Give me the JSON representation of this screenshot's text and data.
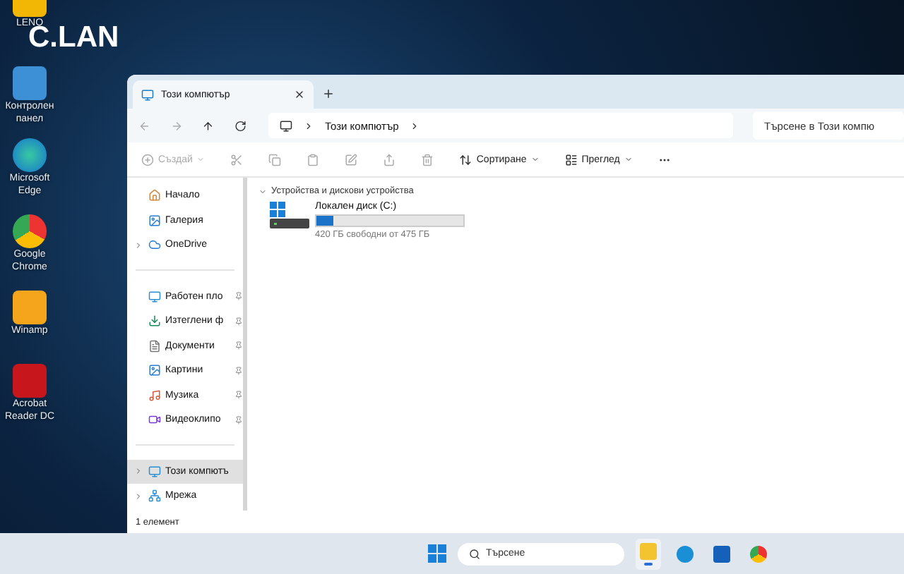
{
  "wallpaper_caption": "C.LAN",
  "desktop_icons": [
    {
      "label": "LENO"
    },
    {
      "label": "Контролен панел"
    },
    {
      "label": "Microsoft Edge"
    },
    {
      "label": "Google Chrome"
    },
    {
      "label": "Winamp"
    },
    {
      "label": "Acrobat Reader DC"
    }
  ],
  "window": {
    "tabs": [
      {
        "label": "Този компютър",
        "selected": true
      }
    ],
    "nav_buttons": [
      {
        "disabled": true
      },
      {
        "disabled": true
      },
      {
        "disabled": false
      },
      {
        "disabled": false
      }
    ],
    "breadcrumb": [
      "Този компютър"
    ],
    "search": {
      "placeholder": "Търсене в Този компю"
    },
    "commands": [
      {
        "kind": "menu",
        "label": "Създай",
        "disabled": true
      },
      {
        "kind": "icon",
        "disabled": true
      },
      {
        "kind": "icon",
        "disabled": true
      },
      {
        "kind": "icon",
        "disabled": true
      },
      {
        "kind": "icon",
        "disabled": true
      },
      {
        "kind": "icon",
        "disabled": true
      },
      {
        "kind": "icon",
        "disabled": true
      },
      {
        "kind": "menu",
        "label": "Сортиране",
        "disabled": false
      },
      {
        "kind": "menu",
        "label": "Преглед",
        "disabled": false
      },
      {
        "kind": "more",
        "disabled": false
      }
    ],
    "sidebar": {
      "groups": [
        [
          {
            "label": "Начало",
            "expandable": false,
            "pinned": false,
            "selected": false
          },
          {
            "label": "Галерия",
            "expandable": false,
            "pinned": false,
            "selected": false
          },
          {
            "label": "OneDrive",
            "expandable": true,
            "pinned": false,
            "selected": false
          }
        ],
        [
          {
            "label": "Работен пло",
            "expandable": false,
            "pinned": true,
            "selected": false
          },
          {
            "label": "Изтеглени ф",
            "expandable": false,
            "pinned": true,
            "selected": false
          },
          {
            "label": "Документи",
            "expandable": false,
            "pinned": true,
            "selected": false
          },
          {
            "label": "Картини",
            "expandable": false,
            "pinned": true,
            "selected": false
          },
          {
            "label": "Музика",
            "expandable": false,
            "pinned": true,
            "selected": false
          },
          {
            "label": "Видеоклипо",
            "expandable": false,
            "pinned": true,
            "selected": false
          }
        ],
        [
          {
            "label": "Този компютъ",
            "expandable": true,
            "pinned": false,
            "selected": true
          },
          {
            "label": "Мрежа",
            "expandable": true,
            "pinned": false,
            "selected": false
          }
        ]
      ]
    },
    "section": {
      "title": "Устройства и дискови устройства",
      "expanded": true,
      "drives": [
        {
          "name": "Локален диск (C:)",
          "level": 0.12,
          "reading": "420 ГБ свободни от 475 ГБ"
        }
      ]
    },
    "status_bar": "1 елемент"
  },
  "taskbar": {
    "search": {
      "placeholder": "Търсене"
    },
    "apps": [
      {
        "active": true
      },
      {
        "active": false
      },
      {
        "active": false
      },
      {
        "active": false
      }
    ]
  }
}
